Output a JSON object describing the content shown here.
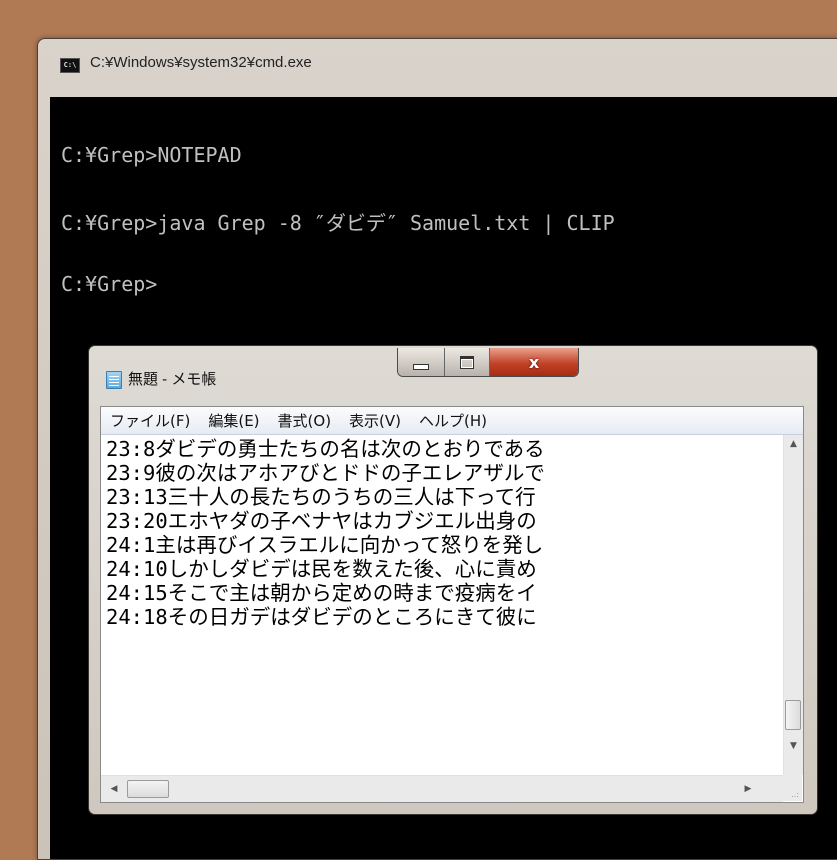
{
  "cmd": {
    "title": "C:¥Windows¥system32¥cmd.exe",
    "icon_text": "C:\\",
    "lines": [
      "C:¥Grep>NOTEPAD",
      "C:¥Grep>java Grep -8 ″ダビデ″ Samuel.txt | CLIP",
      "C:¥Grep>"
    ]
  },
  "notepad": {
    "title": "無題 - メモ帳",
    "window_buttons": {
      "minimize": "minimize",
      "maximize": "maximize",
      "close": "x"
    },
    "menu": [
      "ファイル(F)",
      "編集(E)",
      "書式(O)",
      "表示(V)",
      "ヘルプ(H)"
    ],
    "lines": [
      "23:8ダビデの勇士たちの名は次のとおりである",
      "23:9彼の次はアホアびとドドの子エレアザルで",
      "23:13三十人の長たちのうちの三人は下って行",
      "23:20エホヤダの子ベナヤはカブジエル出身の",
      "24:1主は再びイスラエルに向かって怒りを発し",
      "24:10しかしダビデは民を数えた後、心に責め",
      "24:15そこで主は朝から定めの時まで疫病をイ",
      "24:18その日ガデはダビデのところにきて彼に"
    ],
    "vertical_scroll_position": 0.86,
    "horizontal_scroll_position": 0.0
  },
  "icons": {
    "cmd_icon": "cmd-icon",
    "notepad_icon": "notepad-icon",
    "up_arrow": "▲",
    "down_arrow": "▼",
    "left_arrow": "◀",
    "right_arrow": "▶"
  }
}
